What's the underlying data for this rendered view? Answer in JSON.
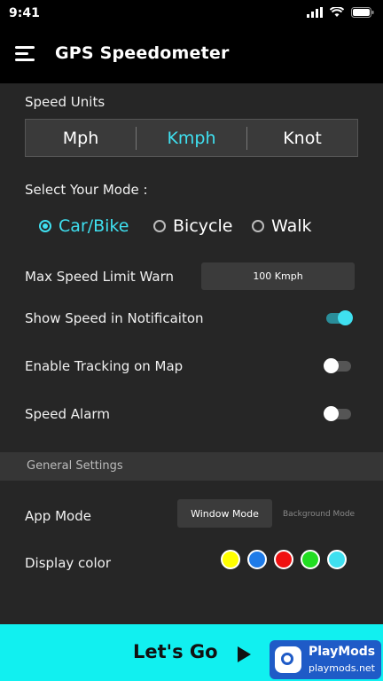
{
  "status": {
    "time": "9:41"
  },
  "appbar": {
    "title": "GPS Speedometer"
  },
  "speed_units": {
    "label": "Speed Units",
    "options": [
      "Mph",
      "Kmph",
      "Knot"
    ],
    "selected": "Kmph"
  },
  "mode": {
    "label": "Select Your Mode :",
    "options": [
      "Car/Bike",
      "Bicycle",
      "Walk"
    ],
    "selected": "Car/Bike"
  },
  "max_speed": {
    "label": "Max Speed Limit Warn",
    "value": "100 Kmph"
  },
  "toggles": {
    "notification": {
      "label": "Show Speed in Notificaiton",
      "on": true
    },
    "tracking": {
      "label": "Enable Tracking on Map",
      "on": false
    },
    "alarm": {
      "label": "Speed Alarm",
      "on": false
    }
  },
  "general": {
    "header": "General Settings"
  },
  "app_mode": {
    "label": "App Mode",
    "window": "Window Mode",
    "background": "Background Mode"
  },
  "display_color": {
    "label": "Display color",
    "colors": [
      "#ffff00",
      "#1e7be8",
      "#f01010",
      "#22dd22",
      "#3fe0f0"
    ]
  },
  "bottom": {
    "cta": "Let's Go"
  },
  "watermark": {
    "name": "PlayMods",
    "url": "playmods.net"
  },
  "accent": "#3fe0f0"
}
